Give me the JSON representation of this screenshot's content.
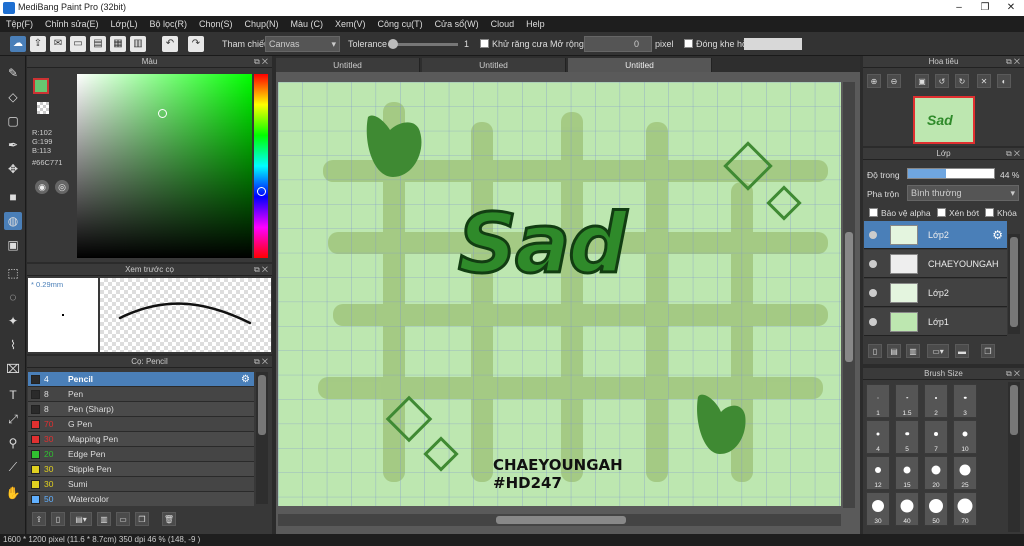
{
  "app": {
    "title": "MediBang Paint Pro (32bit)"
  },
  "menu": [
    "Tệp(F)",
    "Chỉnh sửa(E)",
    "Lớp(L)",
    "Bộ lọc(R)",
    "Chọn(S)",
    "Chụp(N)",
    "Màu (C)",
    "Xem(V)",
    "Công cụ(T)",
    "Cửa sổ(W)",
    "Cloud",
    "Help"
  ],
  "toolbar": {
    "ref_label": "Tham chiếu",
    "ref_value": "Canvas",
    "tolerance_label": "Tolerance",
    "tolerance_value": "1",
    "antialias_label": "Khử răng cưa",
    "expand_label": "Mở rộng",
    "expand_value": "0",
    "expand_unit": "pixel",
    "gap_label": "Đóng khe hở"
  },
  "color_panel": {
    "title": "Màu",
    "r": "R:102",
    "g": "G:199",
    "b": "B:113",
    "hex": "#66C771",
    "fg_color": "#66C771"
  },
  "brush_preview": {
    "title": "Xem trước cọ",
    "size": "0.29mm"
  },
  "brush_panel": {
    "title": "Cọ: Pencil",
    "brushes": [
      {
        "size": "4",
        "name": "Pencil",
        "color": "#2a2a2a"
      },
      {
        "size": "8",
        "name": "Pen",
        "color": "#2a2a2a"
      },
      {
        "size": "8",
        "name": "Pen (Sharp)",
        "color": "#2a2a2a"
      },
      {
        "size": "70",
        "name": "G Pen",
        "color": "#e03030"
      },
      {
        "size": "30",
        "name": "Mapping Pen",
        "color": "#e03030"
      },
      {
        "size": "20",
        "name": "Edge Pen",
        "color": "#30c030"
      },
      {
        "size": "30",
        "name": "Stipple Pen",
        "color": "#e0d020"
      },
      {
        "size": "30",
        "name": "Sumi",
        "color": "#e0d020"
      },
      {
        "size": "50",
        "name": "Watercolor",
        "color": "#60b0ff"
      }
    ]
  },
  "tabs": [
    "Untitled",
    "Untitled",
    "Untitled"
  ],
  "canvas": {
    "big_text": "Sad",
    "line1": "CHAEYOUNGAH",
    "line2": "#HD247"
  },
  "navigator": {
    "title": "Hoa tiêu"
  },
  "layers": {
    "title": "Lớp",
    "opacity_label": "Độ trong",
    "opacity_value": "44 %",
    "opacity_fraction": 0.44,
    "blend_label": "Pha trộn",
    "blend_value": "Bình thường",
    "protect_alpha": "Bảo vệ alpha",
    "clip": "Xén bớt",
    "lock": "Khóa",
    "items": [
      {
        "name": "Lớp2"
      },
      {
        "name": "CHAEYOUNGAH"
      },
      {
        "name": "Lớp2"
      },
      {
        "name": "Lớp1"
      }
    ]
  },
  "brush_size": {
    "title": "Brush Size",
    "sizes": [
      "1",
      "1.5",
      "2",
      "3",
      "4",
      "5",
      "7",
      "10",
      "12",
      "15",
      "20",
      "25",
      "30",
      "40",
      "50",
      "70"
    ]
  },
  "status": {
    "text": "1600 * 1200 pixel   (11.6 * 8.7cm)   350 dpi   46 %   (148, -9 )"
  }
}
